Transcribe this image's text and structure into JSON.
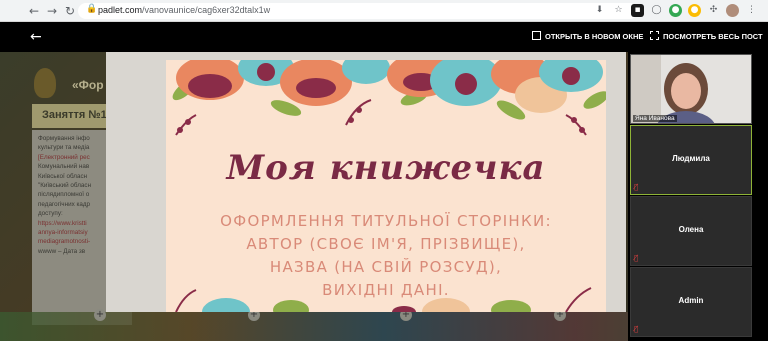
{
  "browser": {
    "back": "←",
    "forward": "→",
    "reload": "↻",
    "url_host": "padlet.com",
    "url_path": "/vanovaunice/cag6xer32dtalx1w"
  },
  "padlet": {
    "title": "«Фор",
    "column_title": "Заняття №1",
    "post_lines": [
      "Формування інфо",
      "культури та медіа",
      "[Електронний рес",
      "Комунальний нав",
      "Київської обласн",
      "\"Київський обласн",
      "післядипломної о",
      "педагогічних кадр",
      "доступу:",
      "https://www.kristti",
      "annya-informatsiy",
      "mediagramotnosti-",
      "wwww – Дата зв"
    ]
  },
  "toolbar": {
    "open_new": "ОТКРЫТЬ В НОВОМ ОКНЕ",
    "view_all": "ПОСМОТРЕТЬ ВЕСЬ ПОСТ"
  },
  "slide": {
    "title": "Моя книжечка",
    "lines": [
      "ОФОРМЛЕННЯ ТИТУЛЬНОЇ СТОРІНКИ:",
      "АВТОР (СВОЄ ІМ'Я, ПРІЗВИЩЕ),",
      "НАЗВА (НА СВІЙ РОЗСУД),",
      "ВИХІДНІ ДАНІ."
    ]
  },
  "participants": {
    "camera_name": "Яна Иванова",
    "tiles": [
      "Людмила",
      "Олена",
      "Admin"
    ]
  },
  "colors": {
    "slide_bg": "#fbe3d0",
    "title_color": "#7a2a45",
    "text_color": "#d98a78",
    "active_border": "#8fb337"
  }
}
